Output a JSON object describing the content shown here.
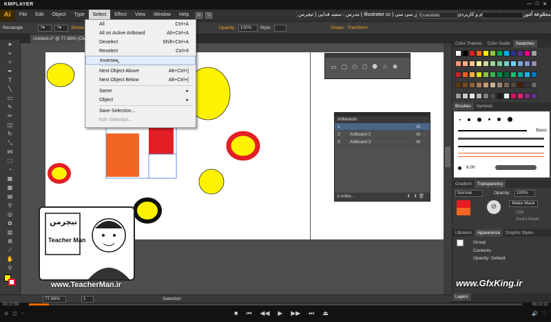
{
  "player": {
    "name": "KMPLAYER",
    "time_elapsed": "00:17:59",
    "time_total": "00:22:22",
    "progress": 0.04
  },
  "app": {
    "logo": "Ai",
    "workspace": "Essentials"
  },
  "menubar": {
    "items": [
      "File",
      "Edit",
      "Object",
      "Type",
      "Select",
      "Effect",
      "View",
      "Window",
      "Help"
    ],
    "active": "Select",
    "br_label": "Br",
    "st_label": "St"
  },
  "title_persian": "مجموعه آموزشی جامع ، گام به گام و کاربردی نرم افزار ایلاستریتور سی سی ( Illustrator cc ) مدرس : سعید فدایی ( تیچرمن ) گروه آموزشی پادشاه گرافیست ها",
  "control": {
    "tool": "Rectangle",
    "stroke_label": "Stroke:",
    "opacity_label": "Opacity:",
    "opacity_value": "100%",
    "style_label": "Style:",
    "shape_label": "Shape:",
    "transform_label": "Transform"
  },
  "doc_tab": {
    "label": "Untitled-2* @ 77.86% (CMYK/Preview)"
  },
  "select_menu": {
    "items": [
      {
        "label": "All",
        "shortcut": "Ctrl+A"
      },
      {
        "label": "All on Active Artboard",
        "shortcut": "Alt+Ctrl+A"
      },
      {
        "label": "Deselect",
        "shortcut": "Shift+Ctrl+A"
      },
      {
        "label": "Reselect",
        "shortcut": "Ctrl+6"
      },
      {
        "label": "Inverse",
        "shortcut": ""
      },
      {
        "label": "Next Object Above",
        "shortcut": "Alt+Ctrl+]"
      },
      {
        "label": "Next Object Below",
        "shortcut": "Alt+Ctrl+["
      },
      {
        "label": "Same",
        "shortcut": "▸"
      },
      {
        "label": "Object",
        "shortcut": "▸"
      },
      {
        "label": "Save Selection...",
        "shortcut": ""
      },
      {
        "label": "Edit Selection...",
        "shortcut": ""
      }
    ]
  },
  "artboards_panel": {
    "title": "Artboards",
    "rows": [
      {
        "num": "1",
        "name": ""
      },
      {
        "num": "2",
        "name": "Artboard 2"
      },
      {
        "num": "3",
        "name": "Artboard 3"
      }
    ],
    "footer": "3 Artbo..."
  },
  "right_panels": {
    "swatch_tabs": [
      "Color Themes",
      "Color Guide",
      "Swatches"
    ],
    "brush_tabs": [
      "Brushes",
      "Symbols"
    ],
    "brush_size": "6.00",
    "brush_name": "Basic",
    "transparency_tabs": [
      "Gradient",
      "Transparency"
    ],
    "blend_mode": "Normal",
    "opacity_label": "Opacity:",
    "opacity_value": "100%",
    "make_mask": "Make Mask",
    "clip": "Clip",
    "invert_mask": "Invert Mask",
    "appearance_tabs": [
      "Libraries",
      "Appearance",
      "Graphic Styles"
    ],
    "group_label": "Group",
    "contents_label": "Contents",
    "opacity_row": "Opacity:",
    "opacity_row_value": "Default",
    "layers_tab": "Layers"
  },
  "status": {
    "zoom": "77.86%",
    "page": "1",
    "mode": "Selection"
  },
  "watermarks": {
    "left": "www.TeacherMan.ir",
    "right": "www.GfxKing.ir",
    "logo_text": "Teacher Man",
    "logo_persian": "تیچرمن"
  },
  "colors": {
    "accent": "#f7a21b",
    "yellow": "#fff200",
    "red": "#e31e24",
    "orange": "#f26522",
    "highlight": "#4a6687"
  }
}
